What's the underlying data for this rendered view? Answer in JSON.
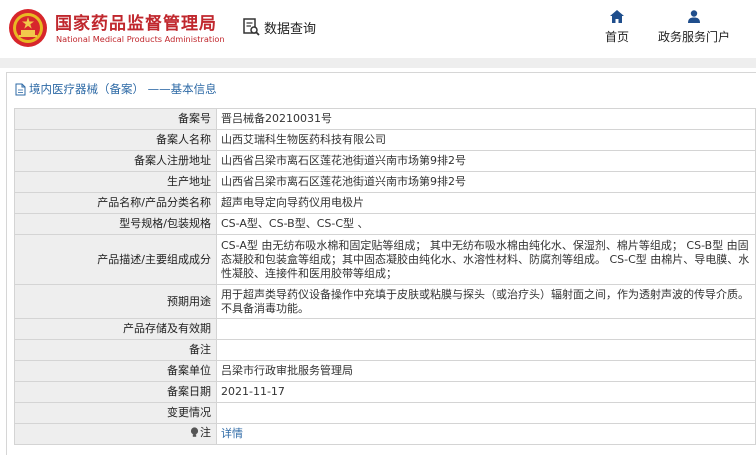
{
  "header": {
    "site_title": "国家药品监督管理局",
    "site_subtitle": "National Medical Products Administration",
    "search_label": "数据查询",
    "nav": [
      {
        "label": "首页",
        "icon": "home-icon"
      },
      {
        "label": "政务服务门户",
        "icon": "user-icon"
      }
    ]
  },
  "panel": {
    "title": "境内医疗器械（备案） ——基本信息"
  },
  "rows": [
    {
      "key": "备案号",
      "value": "晋吕械备20210031号"
    },
    {
      "key": "备案人名称",
      "value": "山西艾瑞科生物医药科技有限公司"
    },
    {
      "key": "备案人注册地址",
      "value": "山西省吕梁市离石区莲花池街道兴南市场第9排2号"
    },
    {
      "key": "生产地址",
      "value": "山西省吕梁市离石区莲花池街道兴南市场第9排2号"
    },
    {
      "key": "产品名称/产品分类名称",
      "value": "超声电导定向导药仪用电极片"
    },
    {
      "key": "型号规格/包装规格",
      "value": "CS-A型、CS-B型、CS-C型 、"
    },
    {
      "key": "产品描述/主要组成成分",
      "value": "CS-A型 由无纺布吸水棉和固定贴等组成； 其中无纺布吸水棉由纯化水、保湿剂、棉片等组成； CS-B型 由固态凝胶和包装盒等组成；其中固态凝胶由纯化水、水溶性材料、防腐剂等组成。 CS-C型 由棉片、导电膜、水性凝胶、连接件和医用胶带等组成；"
    },
    {
      "key": "预期用途",
      "value": "用于超声类导药仪设备操作中充填于皮肤或粘膜与探头（或治疗头）辐射面之间，作为透射声波的传导介质。不具备消毒功能。"
    },
    {
      "key": "产品存储及有效期",
      "value": ""
    },
    {
      "key": "备注",
      "value": ""
    },
    {
      "key": "备案单位",
      "value": "吕梁市行政审批服务管理局"
    },
    {
      "key": "备案日期",
      "value": "2021-11-17"
    },
    {
      "key": "变更情况",
      "value": ""
    },
    {
      "key": "注",
      "value": "详情"
    }
  ],
  "colors": {
    "brand_red": "#c0272d",
    "link_blue": "#2e6aa6",
    "key_bg": "#eeeeee"
  }
}
